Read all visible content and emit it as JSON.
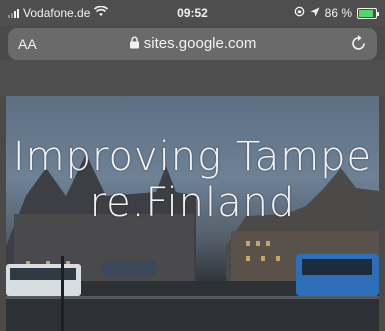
{
  "status": {
    "carrier": "Vodafone.de",
    "time": "09:52",
    "battery_percent": "86 %",
    "battery_level": 0.86
  },
  "browser": {
    "text_size_label": "AA",
    "url": "sites.google.com"
  },
  "page": {
    "title": "Improving Tampere.Finland"
  },
  "colors": {
    "battery": "#4cd964",
    "chrome": "#4e4e4e"
  }
}
